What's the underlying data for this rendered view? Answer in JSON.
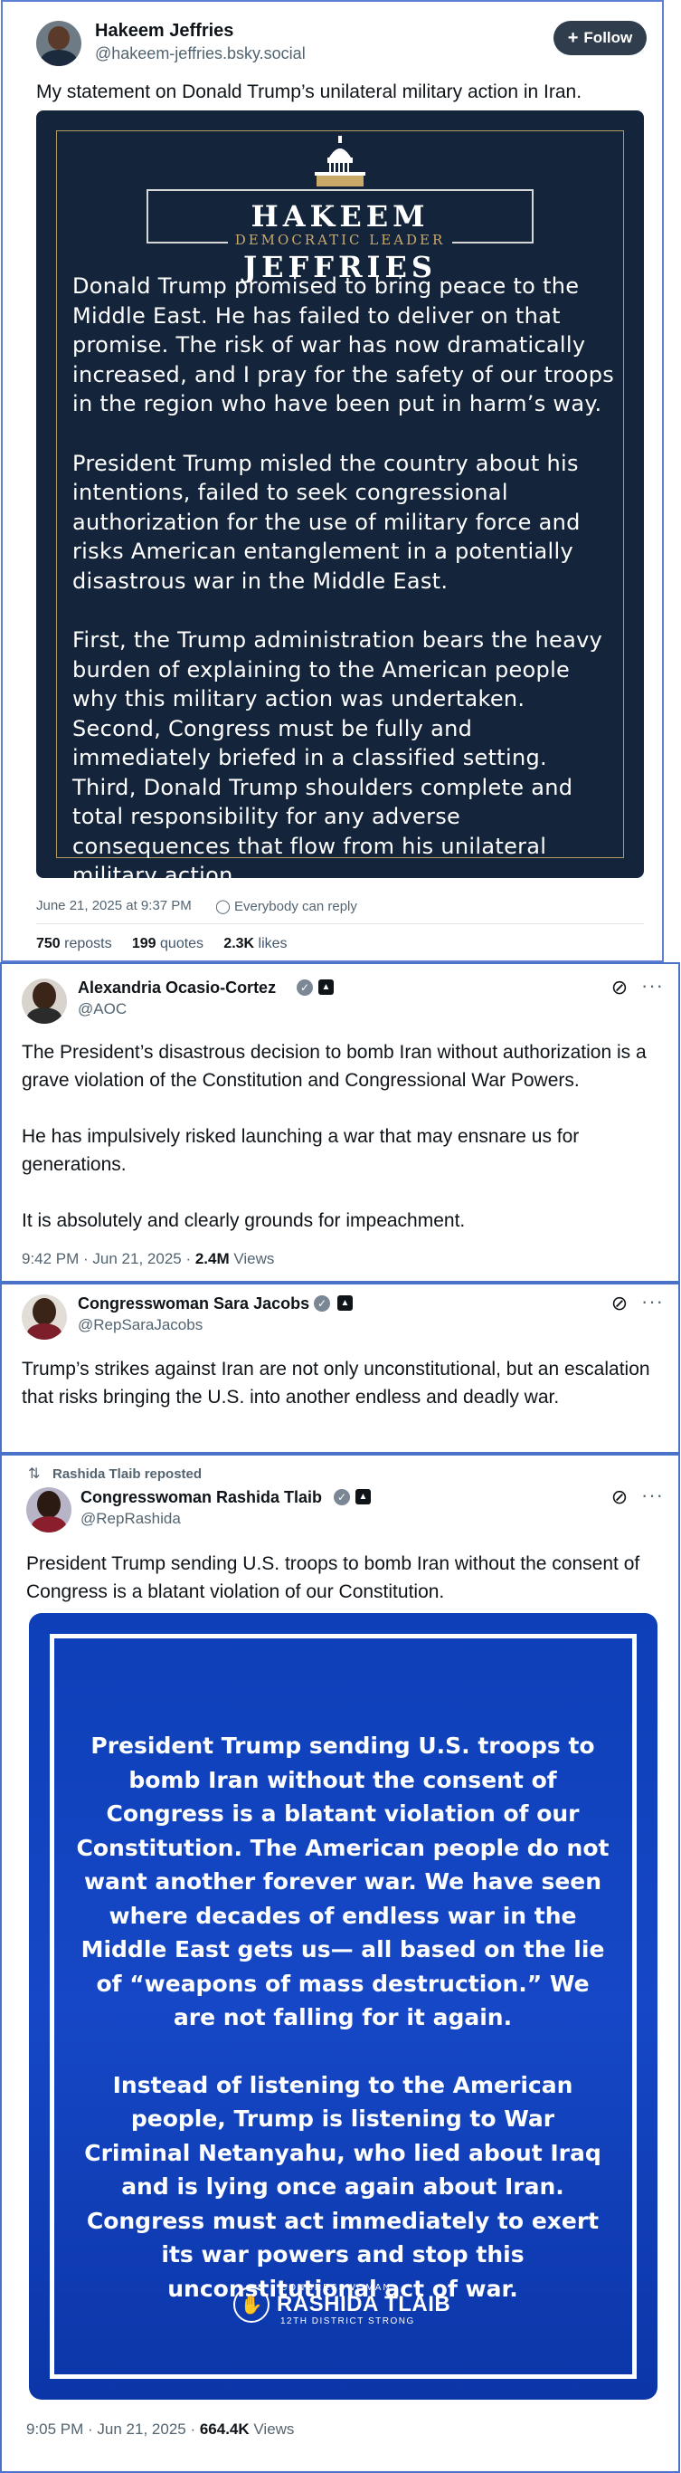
{
  "bsky": {
    "name": "Hakeem Jeffries",
    "handle": "@hakeem-jeffries.bsky.social",
    "follow_label": "Follow",
    "text": "My statement on Donald Trump’s unilateral military action in Iran.",
    "image": {
      "title": "HAKEEM JEFFRIES",
      "subtitle": "DEMOCRATIC LEADER",
      "paragraphs": [
        "Donald Trump promised to bring peace to the Middle East. He has failed to deliver on that promise. The risk of war has now dramatically increased, and I pray for the safety of our troops in the region who have been put in harm’s way.",
        "President Trump misled the country about his intentions, failed to seek congressional authorization for the use of military force and risks American entanglement in a potentially disastrous war in the Middle East.",
        "First, the Trump administration bears the heavy burden of explaining to the American people why this military action was undertaken. Second, Congress must be fully and immediately briefed in a classified setting. Third, Donald Trump shoulders complete and total responsibility for any adverse consequences that flow from his unilateral military action."
      ]
    },
    "timestamp": "June 21, 2025 at 9:37 PM",
    "reply_setting": "Everybody can reply",
    "reposts_count": "750",
    "reposts_label": "reposts",
    "quotes_count": "199",
    "quotes_label": "quotes",
    "likes_count": "2.3K",
    "likes_label": "likes"
  },
  "aoc": {
    "name": "Alexandria Ocasio-Cortez",
    "handle": "@AOC",
    "paragraphs": [
      "The President’s disastrous decision to bomb Iran without authorization is a grave violation of the Constitution and Congressional War Powers.",
      "He has impulsively risked launching a war that may ensnare us for generations.",
      "It is absolutely and clearly grounds for impeachment."
    ],
    "time": "9:42 PM · Jun 21, 2025 · ",
    "views_count": "2.4M",
    "views_label": " Views"
  },
  "jacobs": {
    "name": "Congresswoman Sara Jacobs",
    "handle": "@RepSaraJacobs",
    "text": "Trump’s strikes against Iran are not only unconstitutional, but an escalation that risks bringing the U.S. into another endless and deadly war."
  },
  "tlaib": {
    "reposted_by": "Rashida Tlaib reposted",
    "name": "Congresswoman Rashida Tlaib",
    "handle": "@RepRashida",
    "text": "President Trump sending U.S. troops to bomb Iran without the consent of Congress is a blatant violation of our Constitution.",
    "poster": {
      "paragraphs": [
        "President Trump sending U.S. troops to bomb Iran without the consent of Congress is a blatant violation of our Constitution. The American people do not want another forever war. We have seen where decades of endless war in the Middle East gets us— all based on the lie of “weapons of mass destruction.” We are not falling for it again.",
        "Instead of listening to the American people, Trump is listening to War Criminal Netanyahu, who lied about Iraq and is lying once again about Iran. Congress must act immediately to exert its war powers and stop this unconstitutional act of war."
      ],
      "logo_top": "CONGRESSWOMAN",
      "logo_name": "RASHIDA TLAIB",
      "logo_bottom": "12TH DISTRICT STRONG"
    },
    "time": "9:05 PM · Jun 21, 2025 · ",
    "views_count": "664.4K",
    "views_label": " Views"
  },
  "icons": {
    "verified": "verified-check-icon",
    "gov": "government-badge-icon",
    "grok": "grok-icon",
    "more": "more-icon",
    "repost": "repost-icon",
    "people": "people-icon",
    "plus": "plus-icon"
  },
  "colors": {
    "bsky_button": "#2f3d4c",
    "jeffries_bg": "#14243b",
    "tlaib_bg": "#1647c6",
    "card_border": "#4a72c8"
  }
}
